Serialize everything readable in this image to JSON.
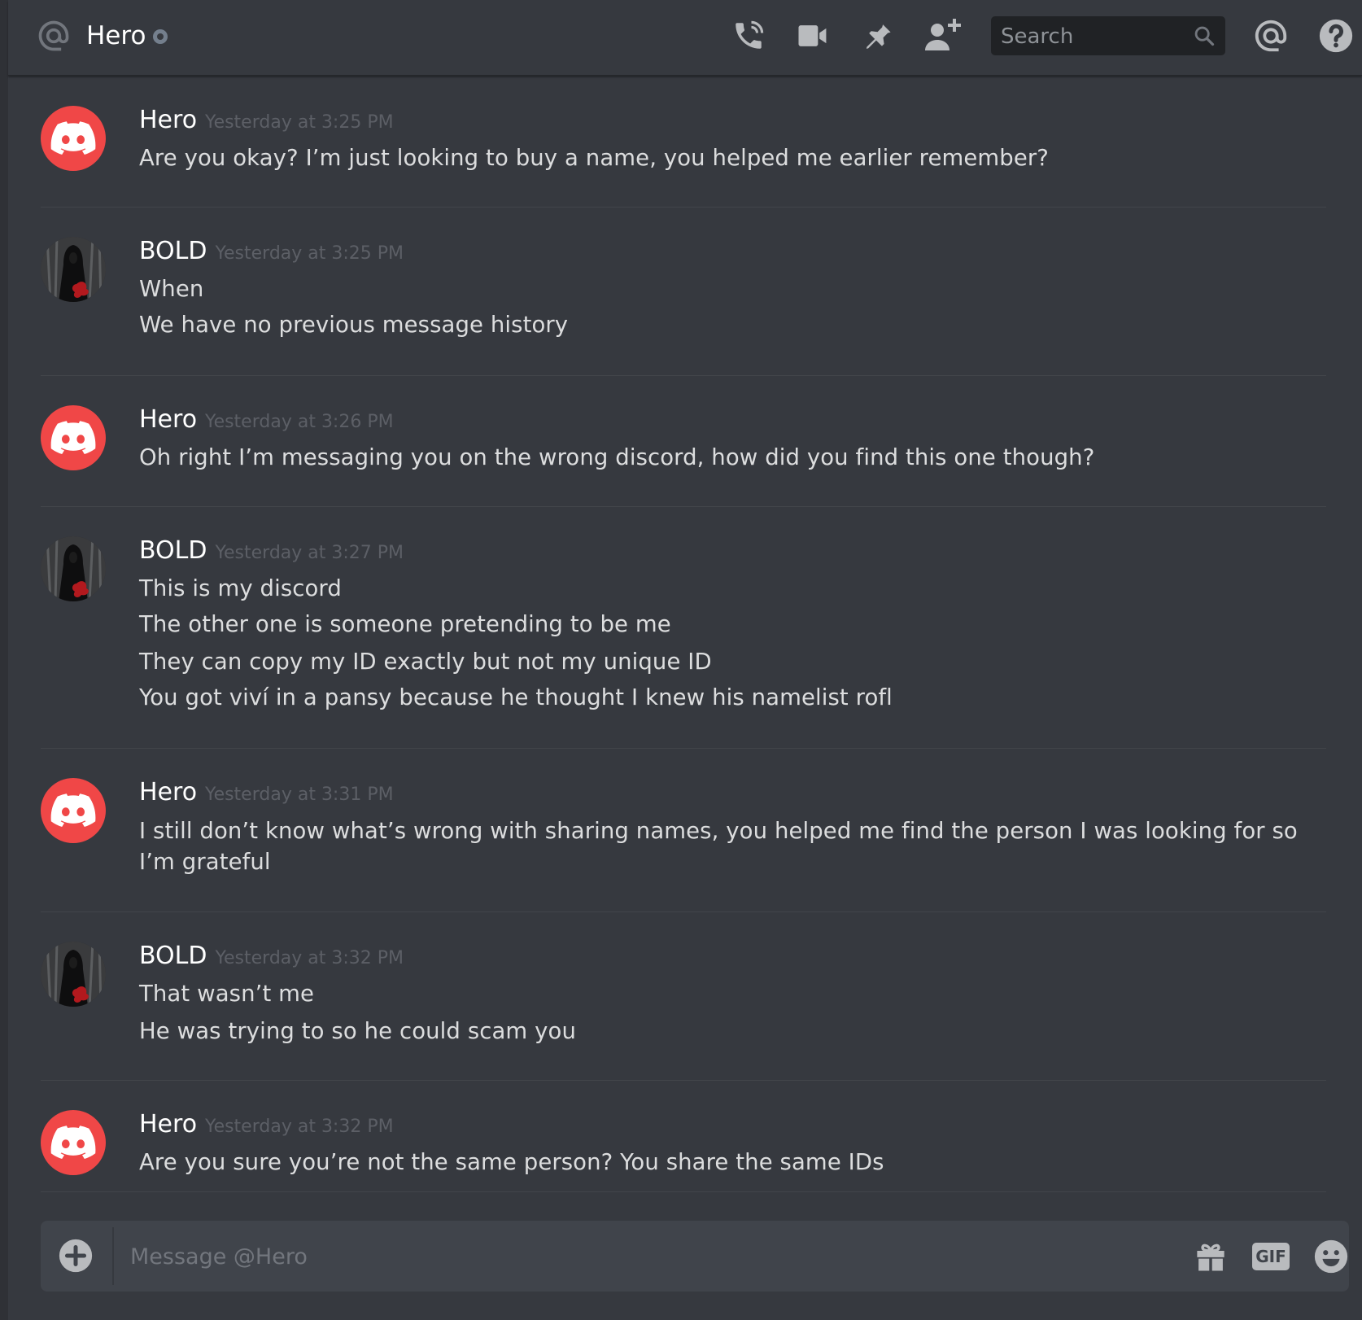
{
  "header": {
    "title": "Hero",
    "search_placeholder": "Search",
    "icons": [
      "at-icon",
      "phone-call-icon",
      "video-camera-icon",
      "pin-icon",
      "add-friend-icon",
      "search-icon",
      "mention-icon",
      "help-icon"
    ]
  },
  "messages": [
    {
      "author": "Hero",
      "timestamp": "Yesterday at 3:25 PM",
      "lines": [
        "Are you okay? I’m just looking to buy a name, you helped me earlier remember?"
      ]
    },
    {
      "author": "BOLD",
      "timestamp": "Yesterday at 3:25 PM",
      "lines": [
        "When",
        "We have no previous message history"
      ]
    },
    {
      "author": "Hero",
      "timestamp": "Yesterday at 3:26 PM",
      "lines": [
        "Oh right I’m messaging you on the wrong discord, how did you find this one though?"
      ]
    },
    {
      "author": "BOLD",
      "timestamp": "Yesterday at 3:27 PM",
      "lines": [
        "This is my discord",
        "The other one is someone pretending to be me",
        "They can copy my ID exactly but not my unique ID",
        "You got viví in a pansy because he thought I knew his namelist rofl"
      ]
    },
    {
      "author": "Hero",
      "timestamp": "Yesterday at 3:31 PM",
      "lines": [
        "I still don’t know what’s wrong with sharing names, you helped me find the person I was looking for so I’m grateful"
      ]
    },
    {
      "author": "BOLD",
      "timestamp": "Yesterday at 3:32 PM",
      "lines": [
        "That wasn’t me",
        "He was trying to so he could scam you"
      ]
    },
    {
      "author": "Hero",
      "timestamp": "Yesterday at 3:32 PM",
      "lines": [
        "Are you sure you’re not the same person? You share the same IDs"
      ]
    }
  ],
  "composer": {
    "placeholder": "Message @Hero",
    "gif_label": "GIF"
  },
  "colors": {
    "background": "#36393f",
    "hero_avatar": "#f04747",
    "timestamp": "#5c5f66",
    "composer": "#40444b"
  }
}
